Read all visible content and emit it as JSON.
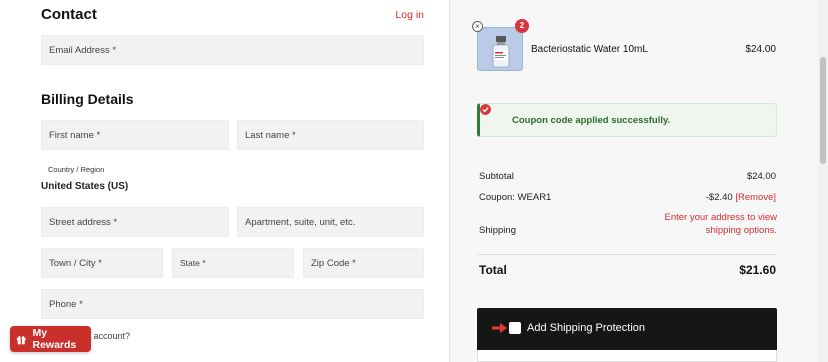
{
  "contact": {
    "heading": "Contact",
    "login_link": "Log in",
    "email_placeholder": "Email Address *"
  },
  "billing": {
    "heading": "Billing Details",
    "first_name_placeholder": "First name *",
    "last_name_placeholder": "Last name *",
    "country_label": "Country / Region",
    "country_value": "United States (US)",
    "street_placeholder": "Street address *",
    "apartment_placeholder": "Apartment, suite, unit, etc.",
    "city_placeholder": "Town / City *",
    "state_placeholder": "State *",
    "zip_placeholder": "Zip Code *",
    "phone_placeholder": "Phone *",
    "account_text_partial": "n account?"
  },
  "rewards": {
    "label": "My Rewards",
    "icon": "gift-icon",
    "color": "#c9302c"
  },
  "cart": {
    "item": {
      "name": "Bacteriostatic Water 10mL",
      "price": "$24.00",
      "quantity": "2",
      "remove_symbol": "×"
    },
    "notice": "Coupon code applied successfully.",
    "subtotal_label": "Subtotal",
    "subtotal_value": "$24.00",
    "coupon_label": "Coupon: WEAR1",
    "coupon_value": "-$2.40",
    "coupon_remove": "[Remove]",
    "shipping_label": "Shipping",
    "shipping_message": "Enter your address to view shipping options.",
    "total_label": "Total",
    "total_value": "$21.60"
  },
  "protection": {
    "label": "Add Shipping Protection"
  },
  "colors": {
    "accent": "#d32f2f",
    "success": "#2e7d32",
    "field_bg": "#f2f2f2"
  }
}
